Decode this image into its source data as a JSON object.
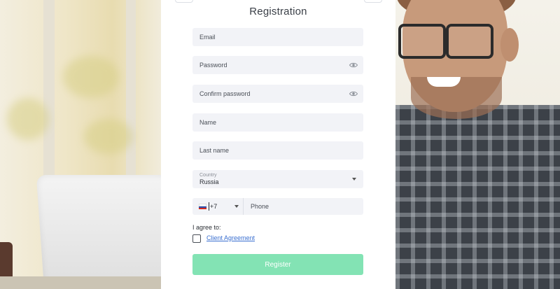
{
  "form": {
    "title": "Registration",
    "email_placeholder": "Email",
    "password_placeholder": "Password",
    "confirm_password_placeholder": "Confirm password",
    "name_placeholder": "Name",
    "last_name_placeholder": "Last name",
    "country_label": "Country",
    "country_value": "Russia",
    "phone_code": "+7",
    "phone_placeholder": "Phone",
    "agree_label": "I agree to:",
    "client_agreement_link": "Client Agreement",
    "register_button": "Register"
  },
  "icons": {
    "password_toggle": "eye-icon",
    "confirm_password_toggle": "eye-icon",
    "country_dropdown": "caret-down-icon",
    "phone_code_dropdown": "caret-down-icon",
    "phone_flag": "russia-flag-icon"
  },
  "colors": {
    "register_button_bg": "#83e3b4",
    "input_bg": "#f2f3f7",
    "link": "#3a6fd0"
  }
}
